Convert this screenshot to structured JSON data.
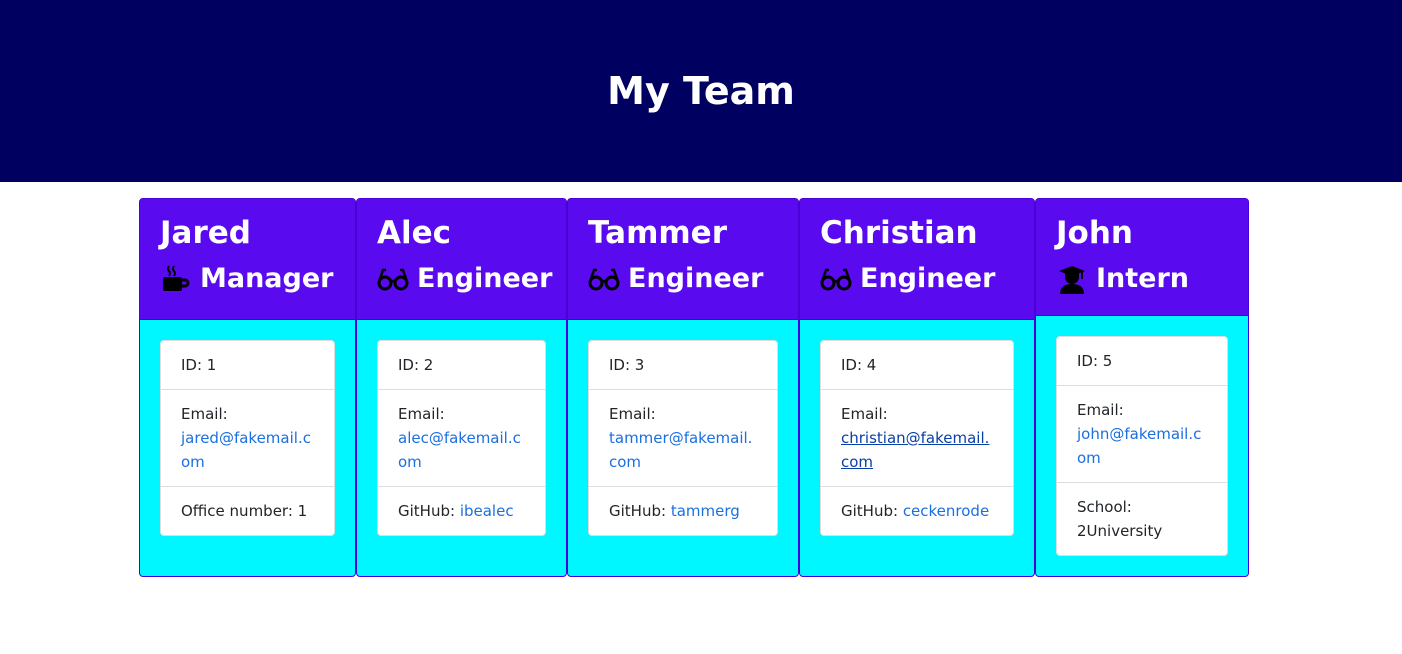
{
  "header": {
    "title": "My Team"
  },
  "colors": {
    "header_bg": "#000060",
    "card_head_bg": "#5a0aee",
    "card_body_bg": "#00f7ff",
    "link": "#1b6fe0"
  },
  "team": [
    {
      "name": "Jared",
      "role": "Manager",
      "icon": "coffee-mug-icon",
      "id_label": "ID: 1",
      "email_label": "Email:",
      "email": "jared@fakemail.com",
      "extra_label": "Office number: 1",
      "extra_value": ""
    },
    {
      "name": "Alec",
      "role": "Engineer",
      "icon": "glasses-icon",
      "id_label": "ID: 2",
      "email_label": "Email:",
      "email": "alec@fakemail.com",
      "extra_label": "GitHub: ",
      "extra_value": "ibealec"
    },
    {
      "name": "Tammer",
      "role": "Engineer",
      "icon": "glasses-icon",
      "id_label": "ID: 3",
      "email_label": "Email:",
      "email": "tammer@fakemail.com",
      "extra_label": "GitHub: ",
      "extra_value": "tammerg"
    },
    {
      "name": "Christian",
      "role": "Engineer",
      "icon": "glasses-icon",
      "id_label": "ID: 4",
      "email_label": "Email:",
      "email": "christian@fakemail.com",
      "extra_label": "GitHub: ",
      "extra_value": "ceckenrode"
    },
    {
      "name": "John",
      "role": "Intern",
      "icon": "graduate-icon",
      "id_label": "ID: 5",
      "email_label": "Email:",
      "email": "john@fakemail.com",
      "extra_label": "School: 2University",
      "extra_value": ""
    }
  ]
}
